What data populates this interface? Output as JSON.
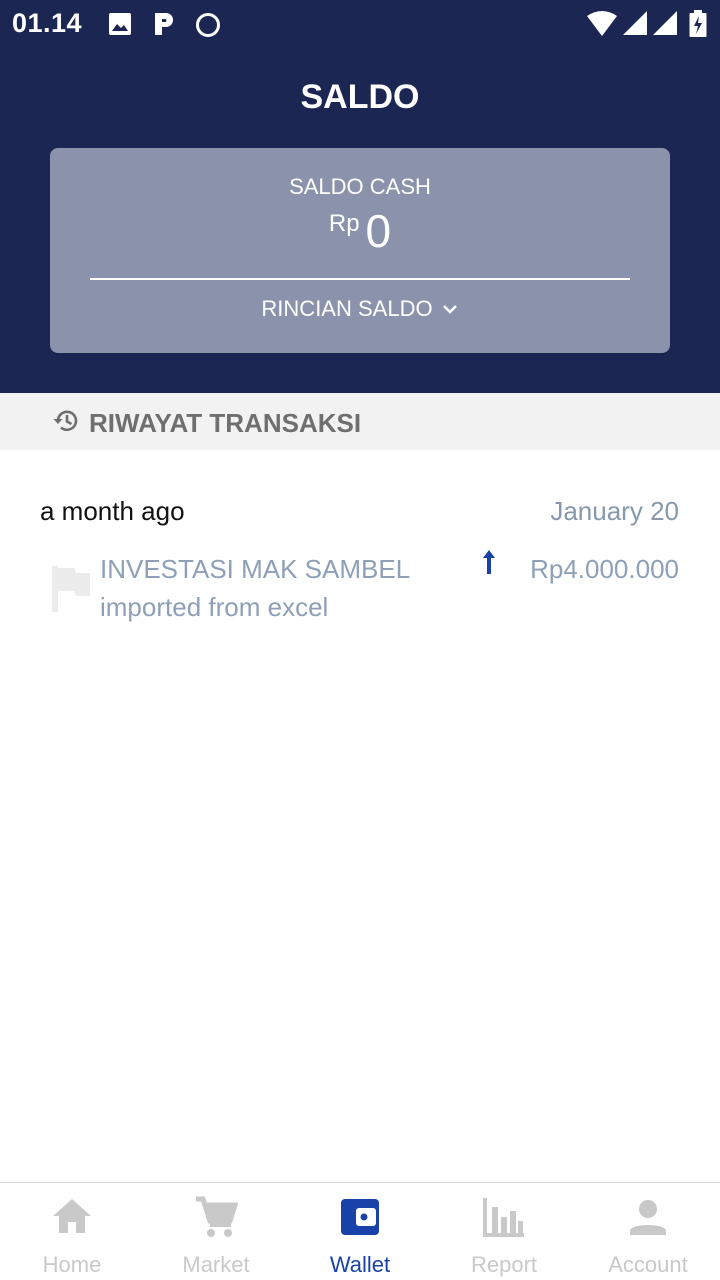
{
  "status_bar": {
    "time": "01.14",
    "left_icons": [
      "image-icon",
      "parking-icon",
      "circle-icon"
    ],
    "right_icons": [
      "wifi-icon",
      "signal-icon",
      "signal-icon",
      "battery-charging-icon"
    ]
  },
  "header": {
    "title": "SALDO"
  },
  "saldo_card": {
    "label": "SALDO CASH",
    "currency": "Rp",
    "amount": "0",
    "details_label": "RINCIAN SALDO",
    "details_icon": "chevron-down-icon"
  },
  "history": {
    "icon": "history-icon",
    "title": "RIWAYAT TRANSAKSI",
    "groups": [
      {
        "label": "a month ago",
        "date": "January 20",
        "transactions": [
          {
            "icon": "flag-icon",
            "title": "INVESTASI MAK SAMBEL",
            "subtitle": "imported from excel",
            "direction_icon": "arrow-up-icon",
            "amount": "Rp4.000.000"
          }
        ]
      }
    ]
  },
  "bottom_nav": {
    "items": [
      {
        "label": "Home",
        "icon": "home-icon",
        "active": false
      },
      {
        "label": "Market",
        "icon": "cart-icon",
        "active": false
      },
      {
        "label": "Wallet",
        "icon": "wallet-icon",
        "active": true
      },
      {
        "label": "Report",
        "icon": "bar-chart-icon",
        "active": false
      },
      {
        "label": "Account",
        "icon": "person-icon",
        "active": false
      }
    ]
  },
  "colors": {
    "header_bg": "#1b2653",
    "card_bg": "#8a93ab",
    "active": "#1942a8",
    "inactive": "#c9c9c9",
    "muted_text": "#8ea0b8"
  }
}
